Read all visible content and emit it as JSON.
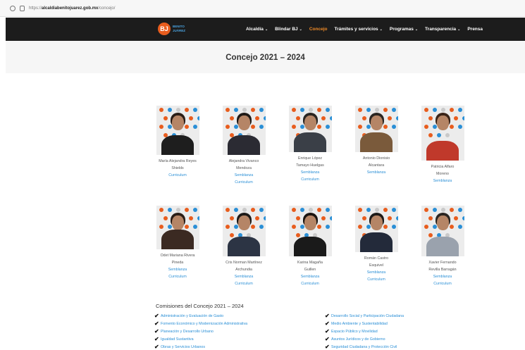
{
  "browser": {
    "url_prefix": "https://",
    "url_host": "alcaldiabenitojuarez.gob.mx",
    "url_path": "/concejo/"
  },
  "nav": {
    "logo": {
      "mark": "BJ",
      "line1": "BENITO",
      "line2": "JUÁREZ"
    },
    "items": [
      {
        "label": "Alcaldía",
        "dropdown": true
      },
      {
        "label": "Blindar BJ",
        "dropdown": true
      },
      {
        "label": "Concejo",
        "dropdown": false
      },
      {
        "label": "Trámites y servicios",
        "dropdown": true
      },
      {
        "label": "Programas",
        "dropdown": true
      },
      {
        "label": "Transparencia",
        "dropdown": true
      },
      {
        "label": "Prensa",
        "dropdown": false
      }
    ],
    "active_index": 2,
    "colors": {
      "bar": "#1c1c1c",
      "active": "#f28c28"
    }
  },
  "page": {
    "title": "Concejo 2021 – 2024"
  },
  "people": [
    {
      "name1": "María Alejandra Reyes",
      "name2": "Shields",
      "links": [
        "Curriculum"
      ],
      "outfit": "#1e1e1e",
      "hair": "#2a1d16"
    },
    {
      "name1": "Alejandra Vivanco",
      "name2": "Mendoza",
      "links": [
        "Semblanza",
        "Curriculum"
      ],
      "outfit": "#2b2b33",
      "hair": "#1f1a17"
    },
    {
      "name1": "Enrique López",
      "name2": "Tamayo Huelgas",
      "links": [
        "Semblanza",
        "Curriculum"
      ],
      "outfit": "#3a3f47",
      "hair": "#2a2521"
    },
    {
      "name1": "Antonio Dionisio",
      "name2": "Alcantara",
      "links": [
        "Semblanza"
      ],
      "outfit": "#7a5a3b",
      "hair": "#2a2521"
    },
    {
      "name1": "Patricia Alfaro",
      "name2": "Moreno",
      "links": [
        "Semblanza"
      ],
      "outfit": "#c0392b",
      "hair": "#3a2418"
    },
    {
      "name1": "Odet Mariana Rivera",
      "name2": "Pineda",
      "links": [
        "Semblanza",
        "Curriculum"
      ],
      "outfit": "#3b2a22",
      "hair": "#2a1d16"
    },
    {
      "name1": "Cris Norman Martínez",
      "name2": "Archundia",
      "links": [
        "Semblanza",
        "Curriculum"
      ],
      "outfit": "#2c3444",
      "hair": "#1d1a18"
    },
    {
      "name1": "Karina Magaña",
      "name2": "Guillen",
      "links": [
        "Semblanza",
        "Curriculum"
      ],
      "outfit": "#1a1a1a",
      "hair": "#1a1410"
    },
    {
      "name1": "Román Castro",
      "name2": "Esquivel",
      "links": [
        "Semblanza",
        "Curriculum"
      ],
      "outfit": "#232a3a",
      "hair": "#1d1a18"
    },
    {
      "name1": "Xavier Fernando",
      "name2": "Revilla Barragán",
      "links": [
        "Semblanza",
        "Curriculum"
      ],
      "outfit": "#9aa2ad",
      "hair": "#2a2521"
    }
  ],
  "commissions": {
    "title": "Comisiones del Concejo 2021 – 2024",
    "left": [
      "Administración y Evaluación de Gasto",
      "Fomento Económico y Modernización Administrativa",
      "Planeación y Desarrollo Urbano",
      "Igualdad Sustantiva",
      "Obras y Servicios Urbanos"
    ],
    "right": [
      "Desarrollo Social y Participación Ciudadana",
      "Medio Ambiente y Sustentabilidad",
      "Espacio Público y Movilidad",
      "Asuntos Jurídicos y de Gobierno",
      "Seguridad Ciudadana y Protección Civil"
    ]
  },
  "colors": {
    "link": "#2a8fd6",
    "logo": "#e85d1e"
  }
}
